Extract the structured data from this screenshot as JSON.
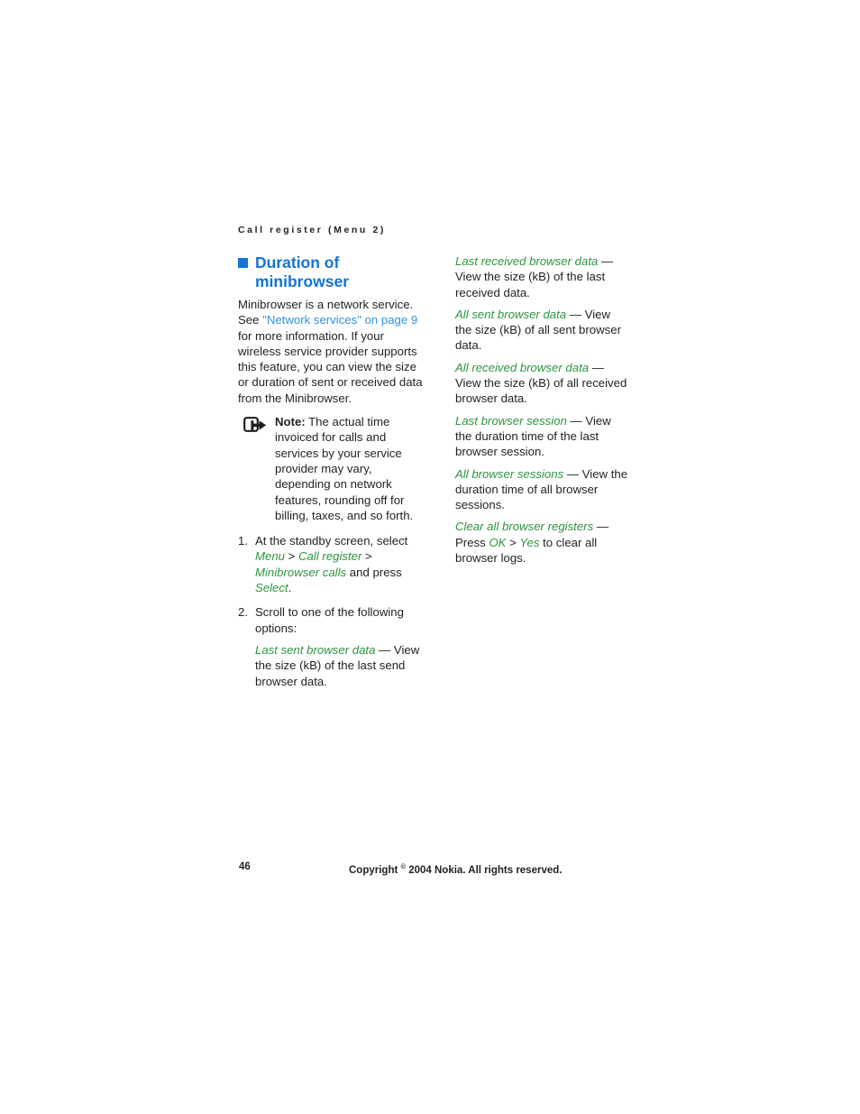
{
  "header": {
    "running_head": "Call register (Menu 2)"
  },
  "section": {
    "heading_line1": "Duration of",
    "heading_line2": "minibrowser",
    "bullet_icon": "square-bullet-icon"
  },
  "left_column": {
    "intro": {
      "part1": "Minibrowser is a network service. See ",
      "link": "\"Network services\" on page 9",
      "part2": " for more information. If your wireless service provider supports this feature, you can view the size or duration of sent or received data from the Minibrowser."
    },
    "note": {
      "icon": "note-pointer-icon",
      "label": "Note:",
      "text": " The actual time invoiced for calls and services by your service provider may vary, depending on network features, rounding off for billing, taxes, and so forth."
    },
    "steps": [
      {
        "number": "1.",
        "text_part1": "At the standby screen, select ",
        "term1": "Menu",
        "sep1": " > ",
        "term2": "Call register",
        "sep2": " > ",
        "term3": "Minibrowser calls",
        "text_part2": " and press ",
        "term4": "Select",
        "text_part3": "."
      },
      {
        "number": "2.",
        "text_part1": "Scroll to one of the following options:",
        "option": {
          "term": "Last sent browser data",
          "desc": " — View the size (kB) of the last send browser data."
        }
      }
    ]
  },
  "right_column": {
    "options": [
      {
        "term": "Last received browser data",
        "desc": " — View the size (kB) of the last received data."
      },
      {
        "term": "All sent browser data",
        "desc": " — View the size (kB) of all sent browser data."
      },
      {
        "term": "All received browser data",
        "desc": " — View the size (kB) of all received browser data."
      },
      {
        "term": "Last browser session",
        "desc": " — View the duration time of the last browser session."
      },
      {
        "term": "All browser sessions",
        "desc": " — View the duration time of all browser sessions."
      }
    ],
    "clear_option": {
      "term": "Clear all browser registers",
      "desc_part1": " — Press ",
      "term_ok": "OK",
      "sep": " > ",
      "term_yes": "Yes",
      "desc_part2": " to clear all browser logs."
    }
  },
  "footer": {
    "page_number": "46",
    "copyright_before": "Copyright ",
    "copyright_symbol": "©",
    "copyright_after": " 2004 Nokia. All rights reserved."
  },
  "colors": {
    "heading_blue": "#1274d4",
    "link_blue": "#2b93dc",
    "ui_green": "#2e9440",
    "body_black": "#231f20",
    "page_background": "#ffffff"
  }
}
